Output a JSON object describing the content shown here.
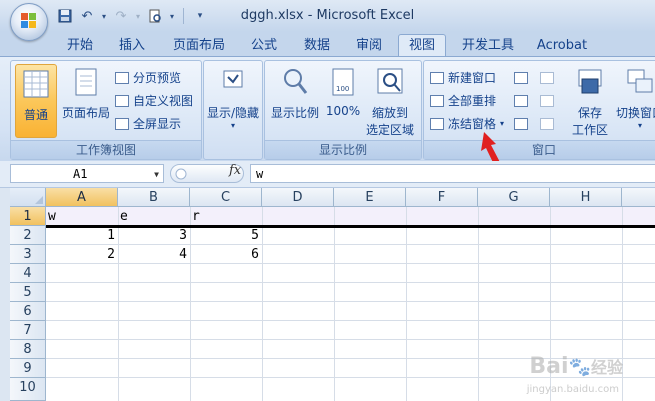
{
  "window": {
    "title": "dggh.xlsx - Microsoft Excel"
  },
  "tabs": [
    {
      "label": "开始",
      "active": false
    },
    {
      "label": "插入",
      "active": false
    },
    {
      "label": "页面布局",
      "active": false
    },
    {
      "label": "公式",
      "active": false
    },
    {
      "label": "数据",
      "active": false
    },
    {
      "label": "审阅",
      "active": false
    },
    {
      "label": "视图",
      "active": true
    },
    {
      "label": "开发工具",
      "active": false
    },
    {
      "label": "Acrobat",
      "active": false
    }
  ],
  "ribbon": {
    "workbook_views": {
      "label": "工作簿视图",
      "normal": "普通",
      "page_layout": "页面布局",
      "page_break": "分页预览",
      "custom_views": "自定义视图",
      "full_screen": "全屏显示"
    },
    "show_hide": {
      "label": "显示/隐藏"
    },
    "zoom": {
      "label": "显示比例",
      "zoom_btn": "显示比例",
      "hundred": "100%",
      "zoom_to_selection_1": "缩放到",
      "zoom_to_selection_2": "选定区域"
    },
    "window": {
      "label": "窗口",
      "new_window": "新建窗口",
      "arrange_all": "全部重排",
      "freeze_panes": "冻结窗格",
      "save_workspace_1": "保存",
      "save_workspace_2": "工作区",
      "switch_windows": "切换窗口"
    }
  },
  "formula_bar": {
    "name_box": "A1",
    "fx": "fx",
    "value": "w"
  },
  "columns": [
    "A",
    "B",
    "C",
    "D",
    "E",
    "F",
    "G",
    "H"
  ],
  "rows": [
    "1",
    "2",
    "3",
    "4",
    "5",
    "6",
    "7",
    "8",
    "9",
    "10"
  ],
  "cells": {
    "A1": "w",
    "B1": "e",
    "C1": "r",
    "A2": "1",
    "B2": "3",
    "C2": "5",
    "A3": "2",
    "B3": "4",
    "C3": "6"
  },
  "watermark": {
    "brand": "Bai",
    "brand2": "经验",
    "url": "jingyan.baidu.com"
  },
  "colors": {
    "accent": "#f9b233",
    "arrow": "#e02020",
    "ribbon_text": "#15428b"
  }
}
